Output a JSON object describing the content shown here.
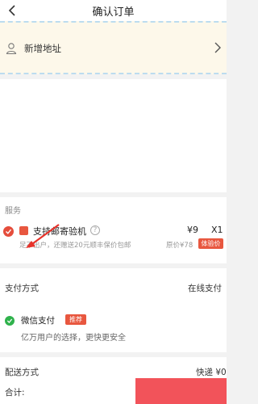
{
  "header": {
    "title": "确认订单",
    "back_icon": "chevron-left-icon"
  },
  "address": {
    "label": "新增地址",
    "icon": "person-location-icon",
    "chevron_icon": "chevron-right-icon"
  },
  "service": {
    "section_label": "服务",
    "selected": true,
    "name": "支持邮寄验机",
    "price": "¥9",
    "quantity": "X1",
    "description": "足不出户，还赠送20元顺丰保价包邮",
    "original_price": "原价¥78",
    "badge": "体验价"
  },
  "payment": {
    "label": "支付方式",
    "value": "在线支付",
    "method_name": "微信支付",
    "method_badge": "推荐",
    "method_desc": "亿万用户的选择，更快更安全"
  },
  "delivery": {
    "label": "配送方式",
    "value": "快递 ¥0"
  },
  "footer": {
    "total_label": "合计:"
  },
  "colors": {
    "accent": "#e8573f",
    "wechat_green": "#2fb24c",
    "address_bg": "#fdf8ea"
  }
}
